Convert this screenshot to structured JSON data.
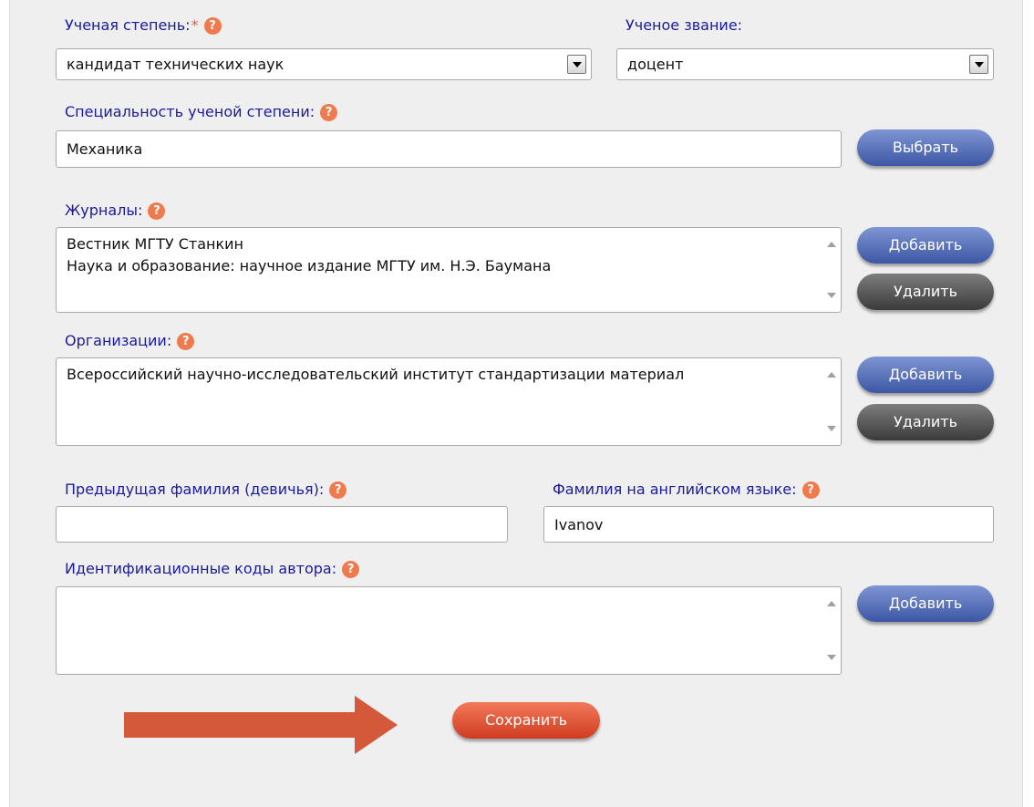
{
  "colors": {
    "label": "#1a1a9c",
    "help": "#ef7a4e",
    "blue_button": "#4d66b3",
    "dark_button": "#505050",
    "save_button": "#e25a3a",
    "arrow": "#d4583a"
  },
  "icons": {
    "help": "question-mark-circle-icon",
    "dropdown": "chevron-down-icon",
    "annotation": "right-arrow-icon"
  },
  "help_glyph": "?",
  "degree": {
    "label": "Ученая степень:",
    "required_mark": "*",
    "value": "кандидат технических наук"
  },
  "title": {
    "label": "Ученое звание:",
    "value": "доцент"
  },
  "specialty": {
    "label": "Специальность ученой степени:",
    "value": "Механика",
    "button": "Выбрать"
  },
  "journals": {
    "label": "Журналы:",
    "items": [
      "Вестник МГТУ Станкин",
      "Наука и образование: научное издание МГТУ им. Н.Э. Баумана"
    ],
    "add": "Добавить",
    "remove": "Удалить"
  },
  "organizations": {
    "label": "Организации:",
    "items": [
      "Всероссийский научно-исследовательский институт стандартизации материал"
    ],
    "add": "Добавить",
    "remove": "Удалить"
  },
  "maiden_name": {
    "label": "Предыдущая фамилия (девичья):",
    "value": ""
  },
  "english_surname": {
    "label": "Фамилия на английском языке:",
    "value": "Ivanov"
  },
  "author_ids": {
    "label": "Идентификационные коды автора:",
    "add": "Добавить"
  },
  "save": "Сохранить"
}
